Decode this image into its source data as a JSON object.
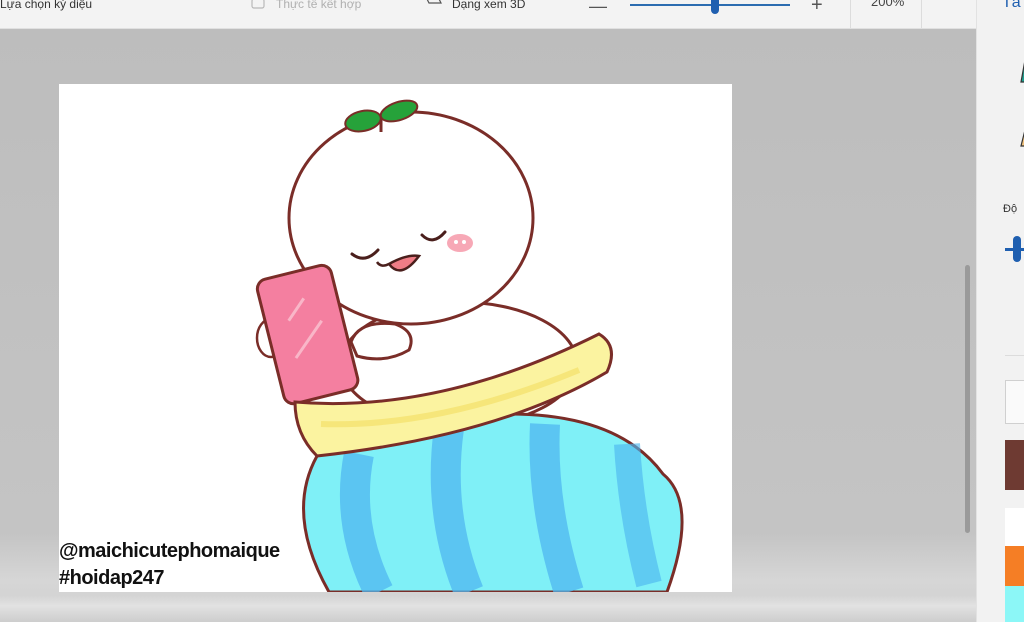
{
  "toolbar": {
    "magic_select_label": "Lựa chọn kỳ diệu",
    "mixed_reality_label": "Thực tế kết hợp",
    "view_3d_label": "Dạng xem 3D",
    "zoom_minus": "—",
    "zoom_plus": "+",
    "zoom_level": "200%",
    "more": "⋯",
    "zoom_fraction": 0.53
  },
  "canvas": {
    "watermark_line1": "@maichicutephomaique",
    "watermark_line2": "#hoidap247"
  },
  "side_panel": {
    "title": "Tấ",
    "opacity_label": "Độ",
    "swatches": [
      "#6e3a32",
      "#ffffff",
      "#f57e25",
      "#8cf7f7"
    ]
  },
  "colors": {
    "accent": "#1f5fb0",
    "canvas_bg": "#c0c0c0",
    "blanket_blue": "#7ff0f7",
    "blanket_yellow": "#fbf3a0",
    "phone_pink": "#f47fa0",
    "leaf_green": "#26a23a"
  }
}
